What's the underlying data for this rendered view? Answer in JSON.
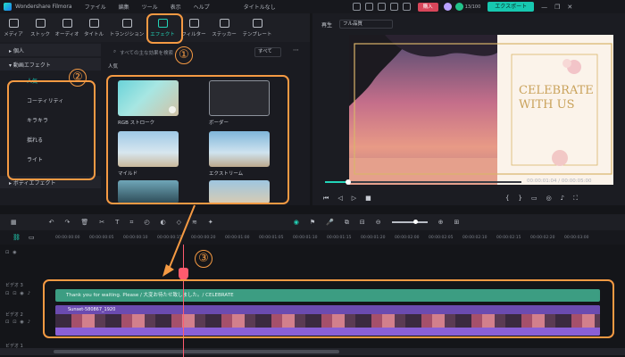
{
  "titlebar": {
    "app_name": "Wondershare Filmora",
    "menu": [
      "ファイル",
      "編集",
      "ツール",
      "表示",
      "ヘルプ"
    ],
    "title": "タイトルなし",
    "buy_label": "購入",
    "export_label": "エクスポート",
    "window_controls": [
      "—",
      "❐",
      "✕"
    ],
    "small_text": "13/100"
  },
  "library_tabs": [
    {
      "label": "メディア",
      "icon": "media-icon"
    },
    {
      "label": "ストック",
      "icon": "stock-icon"
    },
    {
      "label": "オーディオ",
      "icon": "audio-icon"
    },
    {
      "label": "タイトル",
      "icon": "title-icon"
    },
    {
      "label": "トランジション",
      "icon": "transition-icon"
    },
    {
      "label": "エフェクト",
      "icon": "effects-icon",
      "active": true
    },
    {
      "label": "フィルター",
      "icon": "filter-icon"
    },
    {
      "label": "ステッカー",
      "icon": "sticker-icon"
    },
    {
      "label": "テンプレート",
      "icon": "template-icon"
    }
  ],
  "categories": {
    "favorites": "▸ 個人",
    "video_effects": "▾ 動画エフェクト",
    "items": [
      "人気",
      "コーティリティ",
      "キラキラ",
      "揺れる",
      "ライト"
    ],
    "body_effects": "▸ ボディエフェクト"
  },
  "effects": {
    "search_placeholder": "すべての主な効果を検索",
    "sort_label": "すべて",
    "section": "人気",
    "cards": [
      {
        "label": "RGB ストローク"
      },
      {
        "label": "ボーダー"
      },
      {
        "label": "マイルド"
      },
      {
        "label": "エクストリーム"
      },
      {
        "label": ""
      },
      {
        "label": ""
      }
    ]
  },
  "preview": {
    "label": "再生",
    "quality": "フル品質",
    "canvas_text_1": "CELEBRATE",
    "canvas_text_2": "WITH US",
    "timecode": "00:00:01:04",
    "duration": "00:00:05:00",
    "progress": 0.12
  },
  "timeline": {
    "ruler": [
      "00:00:00:00",
      "00:00:00:05",
      "00:00:00:10",
      "00:00:00:15",
      "00:00:00:20",
      "00:00:01:00",
      "00:00:01:05",
      "00:00:01:10",
      "00:00:01:15",
      "00:00:01:20",
      "00:00:02:00",
      "00:00:02:05",
      "00:00:02:10",
      "00:00:02:15",
      "00:00:02:20",
      "00:00:03:00",
      "00:00:03:05"
    ],
    "text_clip": "Thank you for waiting. Please / 大変お待たせ致しました。/ CELEBRATE",
    "video_clip": "Sunset-580867_1920",
    "track_label_1": "ビデオ 3",
    "track_label_2": "ビデオ 2",
    "track_label_3": "ビデオ 1"
  },
  "annotations": [
    "①",
    "②",
    "③"
  ],
  "colors": {
    "accent": "#22d4b8",
    "annotation": "#f59a43",
    "playhead": "#ff5b6e",
    "text_clip": "#3c9d82",
    "video_clip": "#8a5fd6"
  }
}
